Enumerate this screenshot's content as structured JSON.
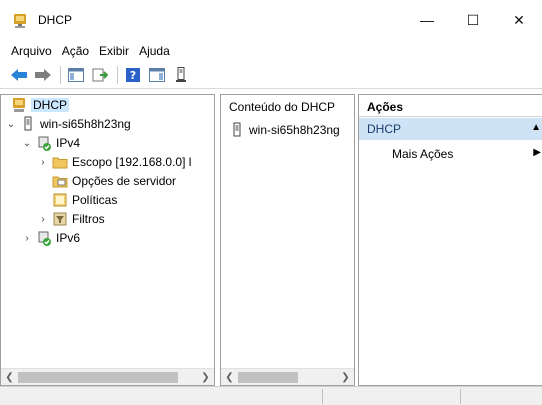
{
  "window": {
    "title": "DHCP",
    "minimize": "—",
    "maximize": "☐",
    "close": "✕"
  },
  "menu": [
    "Arquivo",
    "Ação",
    "Exibir",
    "Ajuda"
  ],
  "tree": {
    "root": "DHCP",
    "server": "win-si65h8h23ng",
    "ipv4": "IPv4",
    "scope": "Escopo [192.168.0.0] l",
    "server_options": "Opções de servidor",
    "policies": "Políticas",
    "filters": "Filtros",
    "ipv6": "IPv6"
  },
  "content": {
    "header": "Conteúdo do DHCP",
    "item": "win-si65h8h23ng"
  },
  "actions": {
    "header": "Ações",
    "section": "DHCP",
    "more": "Mais Ações"
  },
  "colors": {
    "selection": "#cce8ff",
    "action_section": "#cfe3f7"
  }
}
